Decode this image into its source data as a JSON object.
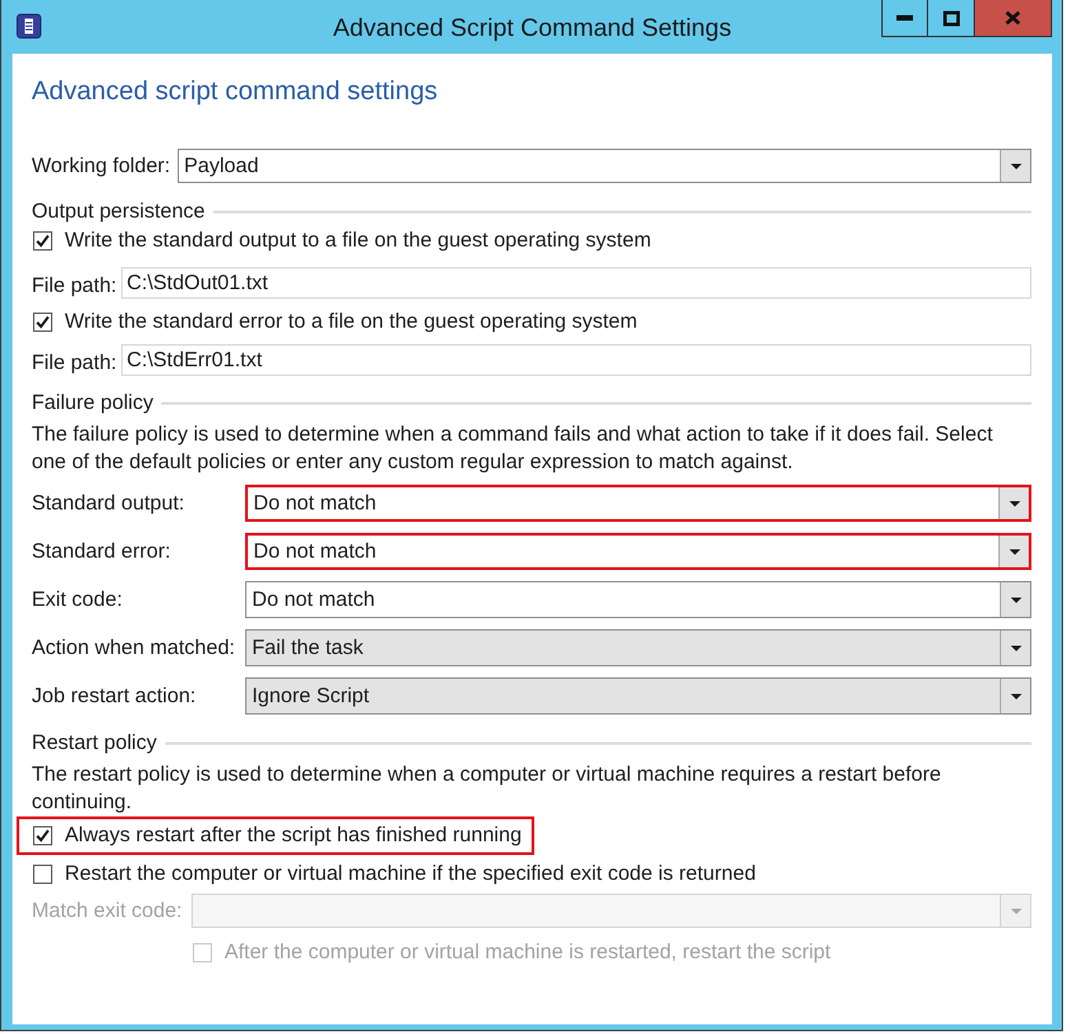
{
  "window": {
    "title": "Advanced Script Command Settings"
  },
  "heading": "Advanced script command settings",
  "working_folder": {
    "label": "Working folder:",
    "value": "Payload",
    "editable": true
  },
  "output_persistence": {
    "title": "Output persistence",
    "items": [
      {
        "checkbox": {
          "label": "Write the standard output to a file on the guest operating system",
          "checked": true
        },
        "file_path": {
          "label": "File path:",
          "value": "C:\\StdOut01.txt"
        }
      },
      {
        "checkbox": {
          "label": "Write the standard error to a file on the guest operating system",
          "checked": true
        },
        "file_path": {
          "label": "File path:",
          "value": "C:\\StdErr01.txt"
        }
      }
    ]
  },
  "failure_policy": {
    "title": "Failure policy",
    "description": "The failure policy is used to determine when a command fails and what action to take if it does fail. Select one of the default policies or enter any custom regular expression to match against.",
    "fields": [
      {
        "label": "Standard output:",
        "value": "Do not match",
        "editable": true,
        "highlighted": true
      },
      {
        "label": "Standard error:",
        "value": "Do not match",
        "editable": true,
        "highlighted": true
      },
      {
        "label": "Exit code:",
        "value": "Do not match",
        "editable": true,
        "highlighted": false
      },
      {
        "label": "Action when matched:",
        "value": "Fail the task",
        "editable": false,
        "highlighted": false
      },
      {
        "label": "Job restart action:",
        "value": "Ignore Script",
        "editable": false,
        "highlighted": false
      }
    ]
  },
  "restart_policy": {
    "title": "Restart policy",
    "description": "The restart policy is used to determine when a computer or virtual machine requires a restart before continuing.",
    "options": [
      {
        "label": "Always restart after the script has finished running",
        "checked": true,
        "highlighted": true
      },
      {
        "label": "Restart the computer or virtual machine if the specified exit code is returned",
        "checked": false,
        "highlighted": false
      }
    ],
    "match_exit_code": {
      "label": "Match exit code:",
      "disabled": true
    },
    "restart_script": {
      "label": "After the computer or virtual machine is restarted, restart the script",
      "checked": false,
      "disabled": true
    }
  }
}
